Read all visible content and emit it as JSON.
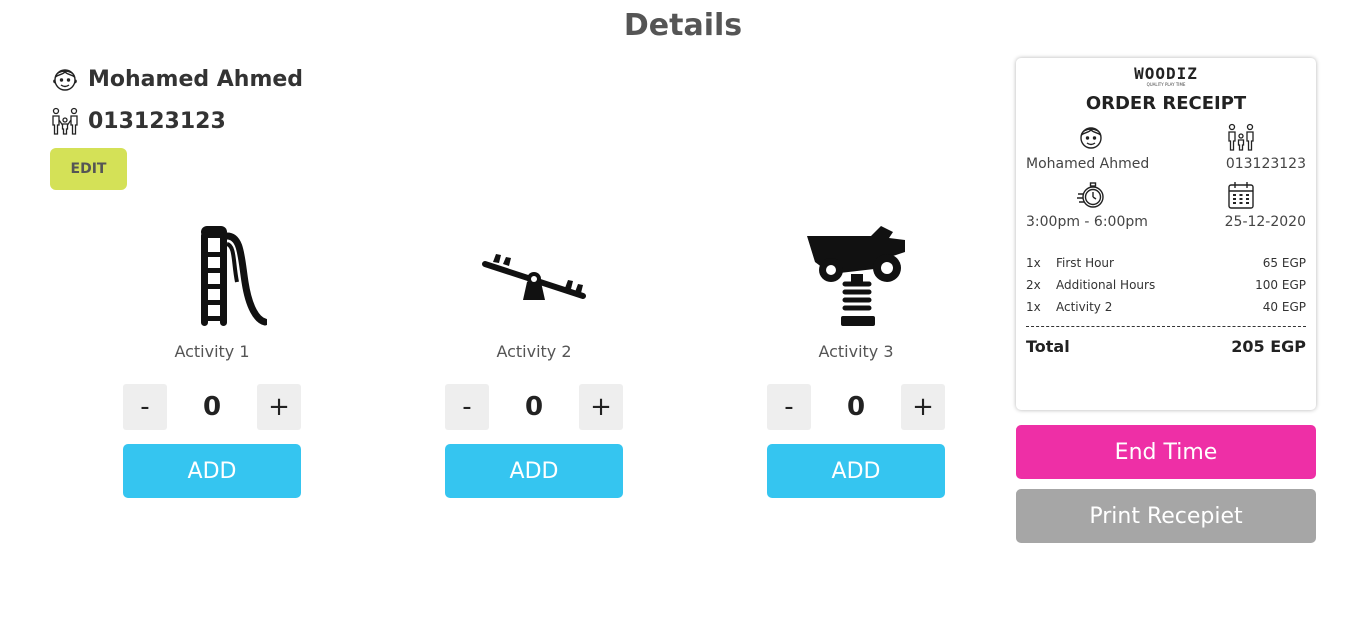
{
  "page": {
    "title": "Details"
  },
  "customer": {
    "name": "Mohamed Ahmed",
    "phone": "013123123",
    "edit_label": "EDIT"
  },
  "activities": [
    {
      "label": "Activity 1",
      "icon": "slide-icon",
      "count": "0",
      "minus": "-",
      "plus": "+",
      "add_label": "ADD"
    },
    {
      "label": "Activity 2",
      "icon": "seesaw-icon",
      "count": "0",
      "minus": "-",
      "plus": "+",
      "add_label": "ADD"
    },
    {
      "label": "Activity 3",
      "icon": "spring-rider-icon",
      "count": "0",
      "minus": "-",
      "plus": "+",
      "add_label": "ADD"
    }
  ],
  "receipt": {
    "logo": "WOODIZ",
    "tagline": "QUALITY PLAY TIME",
    "title": "ORDER RECEIPT",
    "name": "Mohamed Ahmed",
    "phone": "013123123",
    "time": "3:00pm - 6:00pm",
    "date": "25-12-2020",
    "items": [
      {
        "qty": "1x",
        "name": "First Hour",
        "price": "65 EGP"
      },
      {
        "qty": "2x",
        "name": "Additional Hours",
        "price": "100 EGP"
      },
      {
        "qty": "1x",
        "name": "Activity 2",
        "price": "40 EGP"
      }
    ],
    "total_label": "Total",
    "total_value": "205 EGP"
  },
  "actions": {
    "end_label": "End Time",
    "print_label": "Print Recepiet"
  },
  "colors": {
    "accent_edit": "#d4e157",
    "add": "#35c5f0",
    "end": "#ee2fa6",
    "print": "#a6a6a6"
  }
}
